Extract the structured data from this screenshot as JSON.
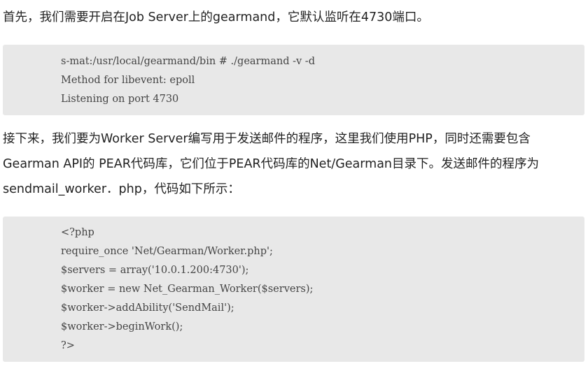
{
  "paragraphs": {
    "intro": "首先，我们需要开启在Job Server上的gearmand，它默认监听在4730端口。",
    "worker_line1": "接下来，我们要为Worker Server编写用于发送邮件的程序，这里我们使用PHP，同时还需要包含",
    "worker_line2": "Gearman API的 PEAR代码库，它们位于PEAR代码库的Net/Gearman目录下。发送邮件的程序为",
    "worker_line3": "sendmail_worker．php，代码如下所示："
  },
  "code_block_1": {
    "lines": [
      "s-mat:/usr/local/gearmand/bin # ./gearmand -v -d",
      "Method for libevent: epoll",
      "Listening on port 4730"
    ]
  },
  "code_block_2": {
    "lines": [
      "<?php",
      "require_once 'Net/Gearman/Worker.php';",
      "$servers = array('10.0.1.200:4730');",
      "$worker = new Net_Gearman_Worker($servers);",
      "$worker->addAbility('SendMail');",
      "$worker->beginWork();",
      "?>"
    ]
  },
  "colors": {
    "text": "#222222",
    "code_background": "#e8e8e8",
    "code_text": "#444444"
  }
}
